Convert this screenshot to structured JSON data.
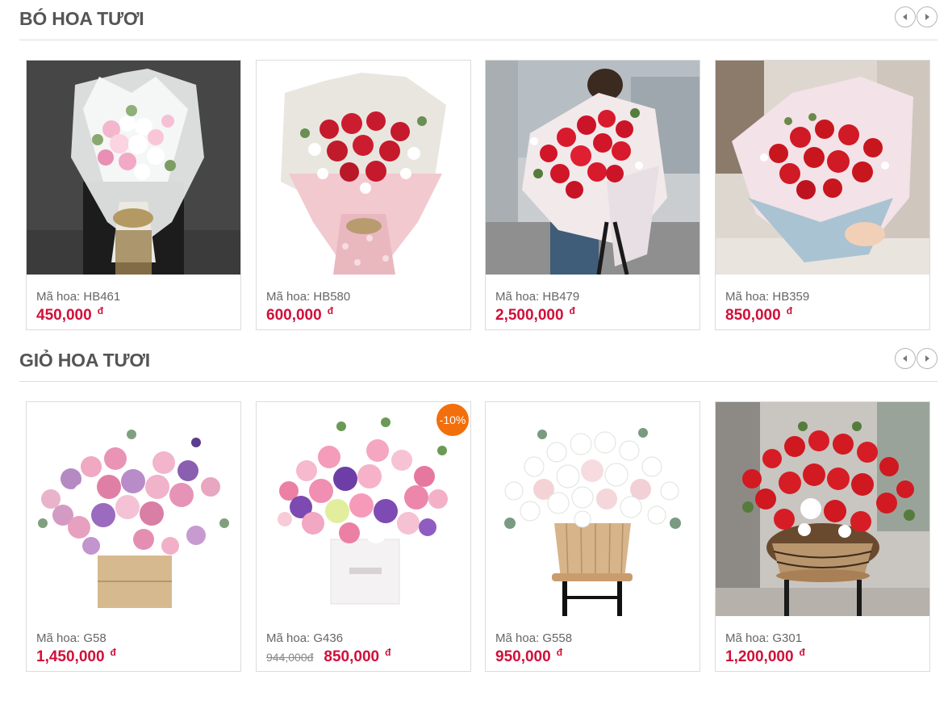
{
  "sections": [
    {
      "title": "BÓ HOA TƯƠI",
      "products": [
        {
          "code": "Mã hoa: HB461",
          "price": "450,000",
          "currency": "đ",
          "image": "white-pink-bouquet"
        },
        {
          "code": "Mã hoa: HB580",
          "price": "600,000",
          "currency": "đ",
          "image": "red-rose-pink-wrap-bouquet"
        },
        {
          "code": "Mã hoa: HB479",
          "price": "2,500,000",
          "currency": "đ",
          "image": "large-red-rose-bouquet"
        },
        {
          "code": "Mã hoa: HB359",
          "price": "850,000",
          "currency": "đ",
          "image": "red-rose-blue-wrap-bouquet"
        }
      ]
    },
    {
      "title": "GIỎ HOA TƯƠI",
      "products": [
        {
          "code": "Mã hoa: G58",
          "price": "1,450,000",
          "currency": "đ",
          "image": "mixed-pink-purple-wooden-box"
        },
        {
          "code": "Mã hoa: G436",
          "old_price": "944,000đ",
          "price": "850,000",
          "currency": "đ",
          "badge": "-10%",
          "image": "pink-purple-white-box"
        },
        {
          "code": "Mã hoa: G558",
          "price": "950,000",
          "currency": "đ",
          "image": "white-rose-wooden-stand"
        },
        {
          "code": "Mã hoa: G301",
          "price": "1,200,000",
          "currency": "đ",
          "image": "red-rose-wicker-basket"
        }
      ]
    }
  ],
  "colors": {
    "price": "#d0103a",
    "badge": "#f26f0c",
    "title": "#555555"
  }
}
